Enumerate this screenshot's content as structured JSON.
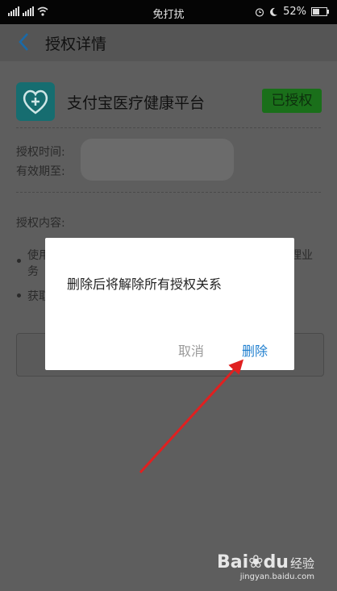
{
  "status_bar": {
    "center": "免打扰",
    "battery": "52%",
    "battery_level": 0.52,
    "icons": [
      "signal-icon",
      "signal-icon",
      "wifi-icon",
      "alarm-icon",
      "moon-icon",
      "battery-icon"
    ]
  },
  "nav": {
    "back_icon": "chevron-left-icon",
    "title": "授权详情"
  },
  "app": {
    "icon": "medical-heart-icon",
    "name": "支付宝医疗健康平台",
    "badge": "已授权"
  },
  "details": {
    "auth_time_label": "授权时间:",
    "valid_until_label": "有效期至:"
  },
  "content": {
    "label": "授权内容:",
    "item1_start": "使用",
    "item1_end": "理业",
    "item1_wrap": "务",
    "item2_start": "获取"
  },
  "dialog": {
    "message": "删除后将解除所有授权关系",
    "cancel": "取消",
    "delete": "删除"
  },
  "watermark": {
    "logo": "Bai",
    "logo_end": "du",
    "jingyan": "经验",
    "url": "jingyan.baidu.com"
  },
  "colors": {
    "accent": "#1f7fcf",
    "annotation": "#e02020",
    "badge_green": "#1a6f1a"
  }
}
